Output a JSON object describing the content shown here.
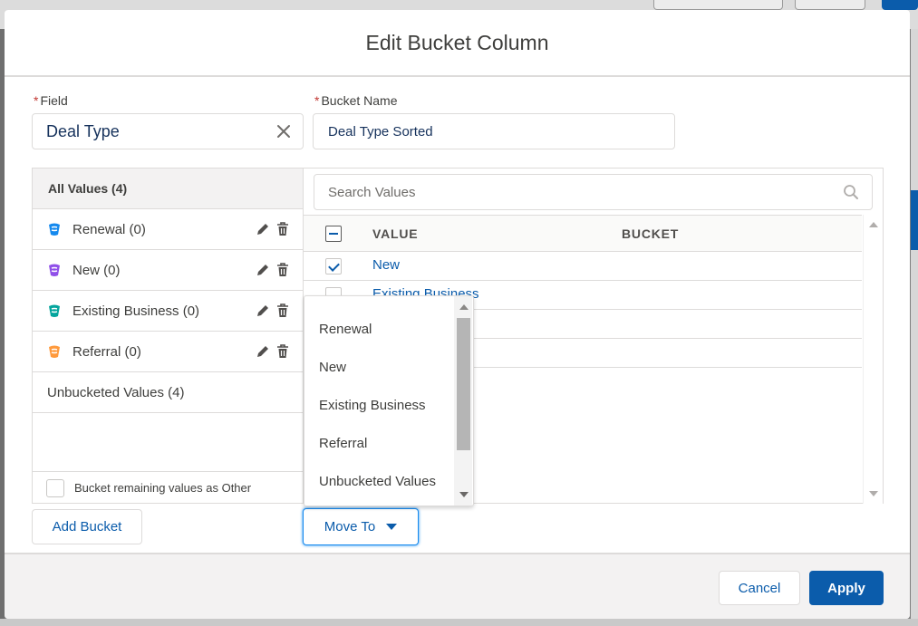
{
  "modal": {
    "title": "Edit Bucket Column"
  },
  "field": {
    "label": "Field",
    "required_mark": "*",
    "value": "Deal Type"
  },
  "bucket_name": {
    "label": "Bucket Name",
    "required_mark": "*",
    "value": "Deal Type Sorted"
  },
  "left_panel": {
    "header": "All Values (4)",
    "buckets": [
      {
        "label": "Renewal (0)",
        "color": "#1589ee"
      },
      {
        "label": "New (0)",
        "color": "#9050e9"
      },
      {
        "label": "Existing Business (0)",
        "color": "#04a59d"
      },
      {
        "label": "Referral (0)",
        "color": "#ff9a3c"
      }
    ],
    "unbucketed": "Unbucketed Values (4)",
    "remaining_label": "Bucket remaining values as Other"
  },
  "search": {
    "placeholder": "Search Values"
  },
  "table": {
    "col_value": "VALUE",
    "col_bucket": "BUCKET",
    "rows": [
      {
        "value": "New",
        "checked": true
      },
      {
        "value": "Existing Business",
        "checked": false
      },
      {
        "value": "",
        "checked": false
      },
      {
        "value": "",
        "checked": false
      }
    ]
  },
  "dropdown": {
    "options": [
      "Renewal",
      "New",
      "Existing Business",
      "Referral",
      "Unbucketed Values"
    ]
  },
  "buttons": {
    "add_bucket": "Add Bucket",
    "move_to": "Move To",
    "cancel": "Cancel",
    "apply": "Apply"
  },
  "colors": {
    "brand": "#0b5cab",
    "required": "#c23934",
    "focus": "#1589ee"
  }
}
